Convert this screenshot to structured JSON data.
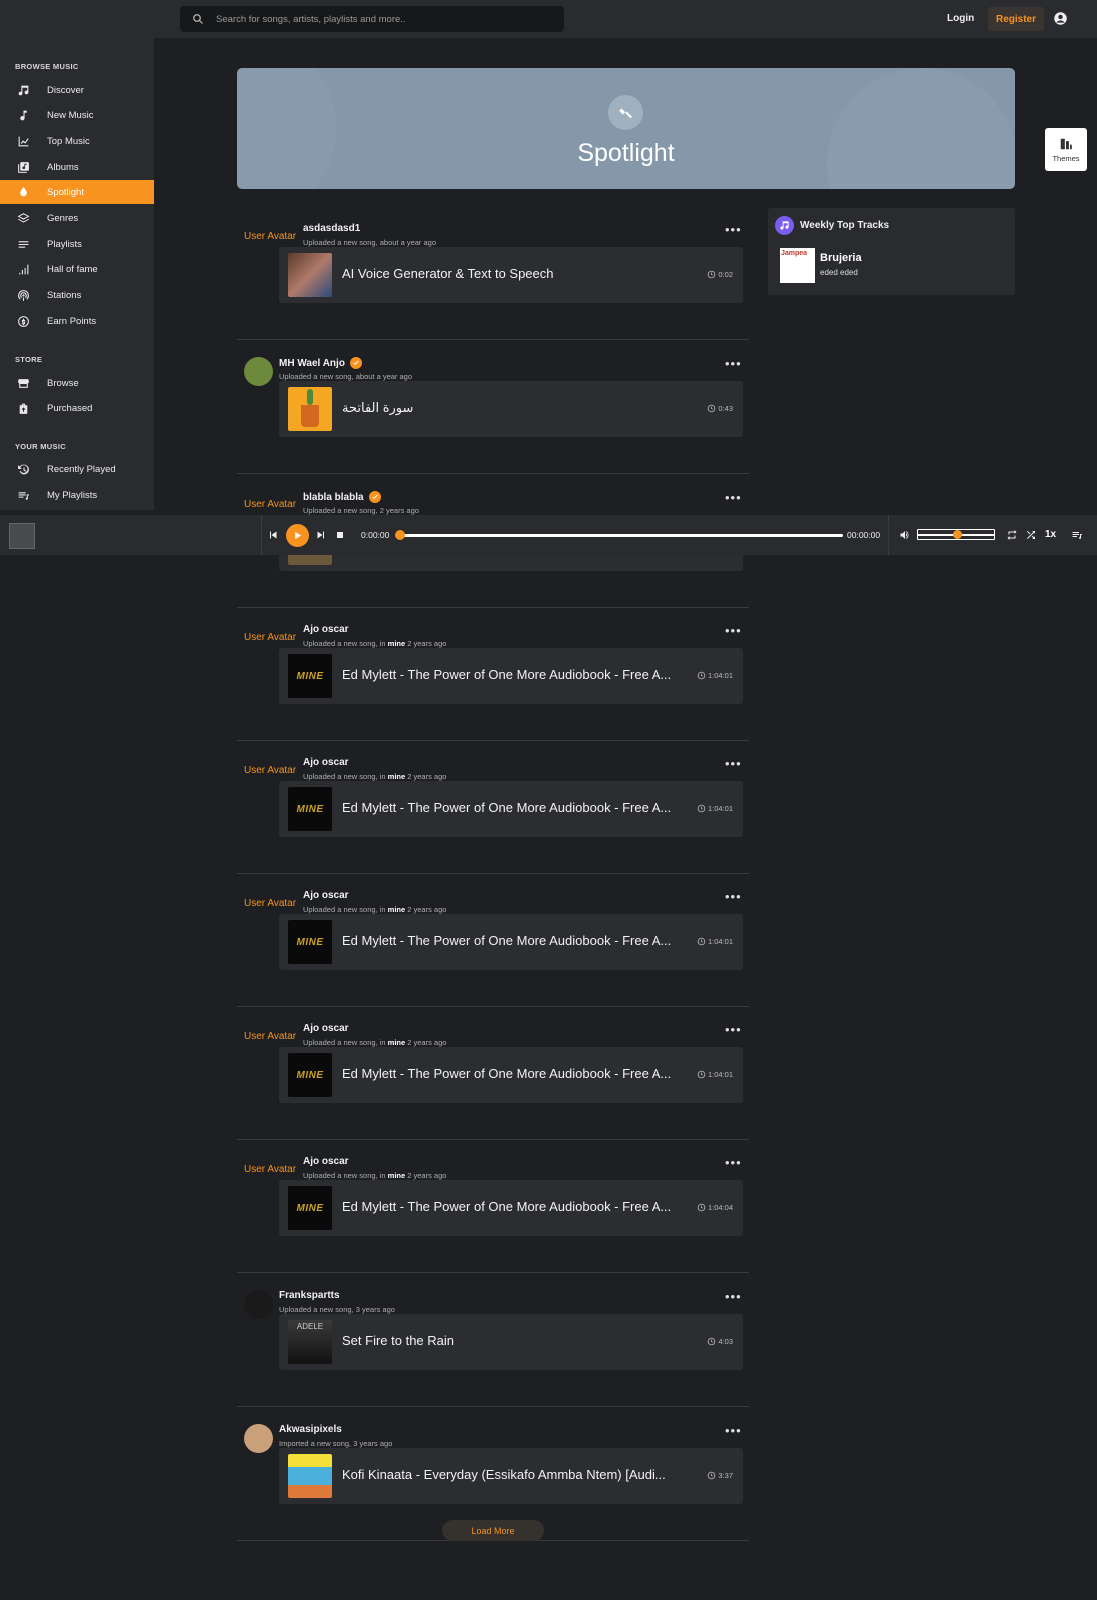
{
  "search": {
    "placeholder": "Search for songs, artists, playlists and more.."
  },
  "header": {
    "login": "Login",
    "register": "Register"
  },
  "themes": {
    "label": "Themes"
  },
  "sidebar": {
    "sections": [
      {
        "title": "BROWSE MUSIC"
      },
      {
        "title": "STORE"
      },
      {
        "title": "YOUR MUSIC"
      }
    ],
    "items": [
      {
        "label": "Discover",
        "icon": "music-note-icon"
      },
      {
        "label": "New Music",
        "icon": "note-icon"
      },
      {
        "label": "Top Music",
        "icon": "trending-icon"
      },
      {
        "label": "Albums",
        "icon": "album-icon"
      },
      {
        "label": "Spotlight",
        "icon": "spotlight-icon",
        "active": true
      },
      {
        "label": "Genres",
        "icon": "layers-icon"
      },
      {
        "label": "Playlists",
        "icon": "playlist-icon"
      },
      {
        "label": "Hall of fame",
        "icon": "bar-chart-icon"
      },
      {
        "label": "Stations",
        "icon": "podcast-icon"
      },
      {
        "label": "Earn Points",
        "icon": "points-icon"
      },
      {
        "label": "Browse",
        "icon": "store-icon"
      },
      {
        "label": "Purchased",
        "icon": "bag-icon"
      },
      {
        "label": "Recently Played",
        "icon": "history-icon"
      },
      {
        "label": "My Playlists",
        "icon": "queue-icon"
      }
    ]
  },
  "banner": {
    "title": "Spotlight"
  },
  "weekly": {
    "title": "Weekly Top Tracks",
    "track": {
      "title": "Brujeria",
      "artist": "eded eded",
      "cover_text": "Jampea"
    }
  },
  "posts": [
    {
      "avatar_alt": "User Avatar",
      "user": "asdasdasd1",
      "verified": false,
      "sub_pre": "Uploaded a new song, about a year ago",
      "sub_bold": "",
      "sub_post": "",
      "title": "AI Voice Generator & Text to Speech",
      "duration": "0:02",
      "cover": "portrait"
    },
    {
      "avatar_alt": "",
      "user": "MH Wael Anjo",
      "verified": true,
      "sub_pre": "Uploaded a new song, about a year ago",
      "sub_bold": "",
      "sub_post": "",
      "title": "سورة الفاتحة",
      "duration": "0:43",
      "cover": "cactus"
    },
    {
      "avatar_alt": "User Avatar",
      "user": "blabla blabla",
      "verified": true,
      "sub_pre": "Uploaded a new song, 2 years ago",
      "sub_bold": "",
      "sub_post": "",
      "title": "",
      "duration": "",
      "cover": "hidden"
    },
    {
      "avatar_alt": "User Avatar",
      "user": "Ajo oscar",
      "verified": false,
      "sub_pre": "Uploaded a new song, in ",
      "sub_bold": "mine",
      "sub_post": " 2 years ago",
      "title": "Ed Mylett - The Power of One More Audiobook - Free A...",
      "duration": "1:04:01",
      "cover": "mine"
    },
    {
      "avatar_alt": "User Avatar",
      "user": "Ajo oscar",
      "verified": false,
      "sub_pre": "Uploaded a new song, in ",
      "sub_bold": "mine",
      "sub_post": " 2 years ago",
      "title": "Ed Mylett - The Power of One More Audiobook - Free A...",
      "duration": "1:04:01",
      "cover": "mine"
    },
    {
      "avatar_alt": "User Avatar",
      "user": "Ajo oscar",
      "verified": false,
      "sub_pre": "Uploaded a new song, in ",
      "sub_bold": "mine",
      "sub_post": " 2 years ago",
      "title": "Ed Mylett - The Power of One More Audiobook - Free A...",
      "duration": "1:04:01",
      "cover": "mine"
    },
    {
      "avatar_alt": "User Avatar",
      "user": "Ajo oscar",
      "verified": false,
      "sub_pre": "Uploaded a new song, in ",
      "sub_bold": "mine",
      "sub_post": " 2 years ago",
      "title": "Ed Mylett - The Power of One More Audiobook - Free A...",
      "duration": "1:04:01",
      "cover": "mine"
    },
    {
      "avatar_alt": "User Avatar",
      "user": "Ajo oscar",
      "verified": false,
      "sub_pre": "Uploaded a new song, in ",
      "sub_bold": "mine",
      "sub_post": " 2 years ago",
      "title": "Ed Mylett - The Power of One More Audiobook - Free A...",
      "duration": "1:04:04",
      "cover": "mine"
    },
    {
      "avatar_alt": "",
      "user": "Frankspartts",
      "verified": false,
      "sub_pre": "Uploaded a new song, 3 years ago",
      "sub_bold": "",
      "sub_post": "",
      "title": "Set Fire to the Rain",
      "duration": "4:03",
      "cover": "adele",
      "cover_text": "ADELE"
    },
    {
      "avatar_alt": "",
      "user": "Akwasipixels",
      "verified": false,
      "sub_pre": "Imported a new song, 3 years ago",
      "sub_bold": "",
      "sub_post": "",
      "title": "Kofi Kinaata - Everyday (Essikafo Ammba Ntem) [Audi...",
      "duration": "3:37",
      "cover": "kofi"
    }
  ],
  "mine_cover_text": "MINE",
  "player": {
    "current_time": "0:00:00",
    "total_time": "00:00:00",
    "progress": 0,
    "volume": 0.5,
    "speed": "1x"
  },
  "load_more": "Load More",
  "colors": {
    "accent": "#f7931e",
    "bg": "#1e1f22",
    "panel": "#2a2b2e",
    "banner": "#8498aa"
  }
}
